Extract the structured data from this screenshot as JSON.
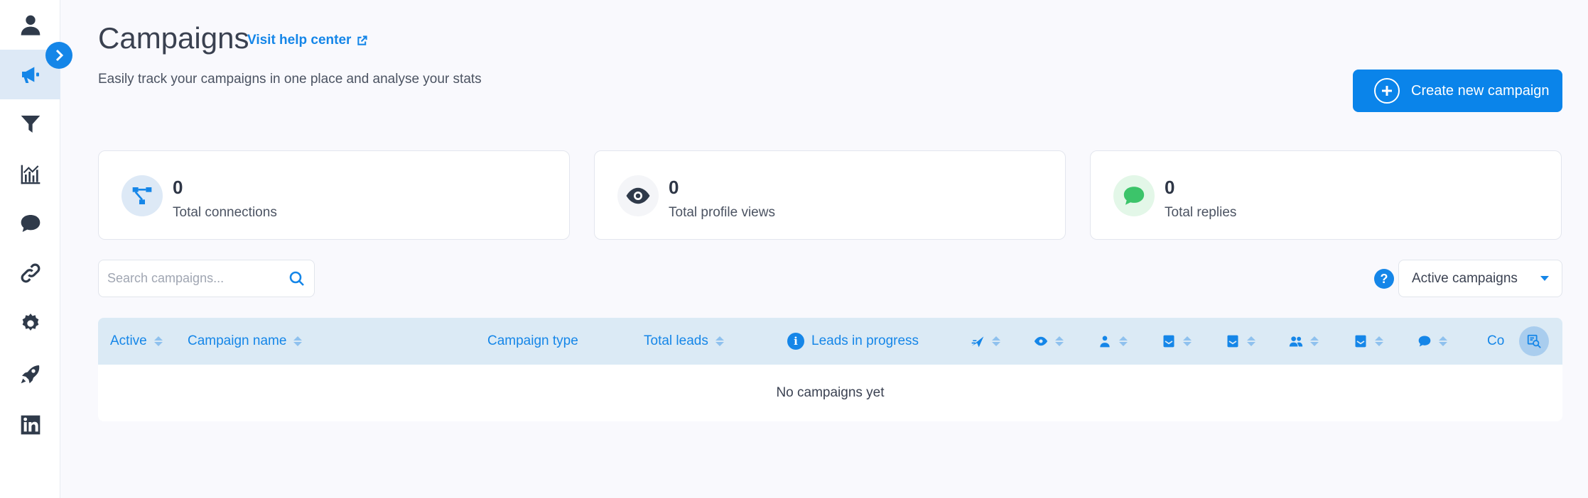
{
  "header": {
    "title": "Campaigns",
    "help_link": "Visit help center",
    "subtitle": "Easily track your campaigns in one place and analyse your stats",
    "create_button": "Create new campaign"
  },
  "stats": [
    {
      "value": "0",
      "label": "Total connections",
      "icon": "network-icon",
      "color": "#1586e8"
    },
    {
      "value": "0",
      "label": "Total profile views",
      "icon": "eye-icon",
      "color": "#2f3a4a"
    },
    {
      "value": "0",
      "label": "Total replies",
      "icon": "chat-bubble-icon",
      "color": "#3cc46a"
    }
  ],
  "search": {
    "placeholder": "Search campaigns..."
  },
  "filter": {
    "selected": "Active campaigns"
  },
  "table": {
    "columns": {
      "active": "Active",
      "name": "Campaign name",
      "type": "Campaign type",
      "total_leads": "Total leads",
      "in_progress": "Leads in progress",
      "truncated": "Co"
    },
    "icon_columns": [
      "send-icon",
      "eye-icon",
      "person-question-icon",
      "mail-icon",
      "mail-icon",
      "users-icon",
      "mail-icon",
      "chat-icon"
    ],
    "empty_message": "No campaigns yet"
  },
  "sidebar": {
    "items": [
      "profile-icon",
      "megaphone-icon",
      "filter-icon",
      "analytics-icon",
      "chat-icon",
      "link-icon",
      "settings-icon",
      "rocket-icon",
      "linkedin-icon"
    ],
    "active": "megaphone-icon"
  },
  "colors": {
    "accent": "#1586e8",
    "header_bg": "#dbeaf5",
    "page_bg": "#f9f9fd"
  }
}
